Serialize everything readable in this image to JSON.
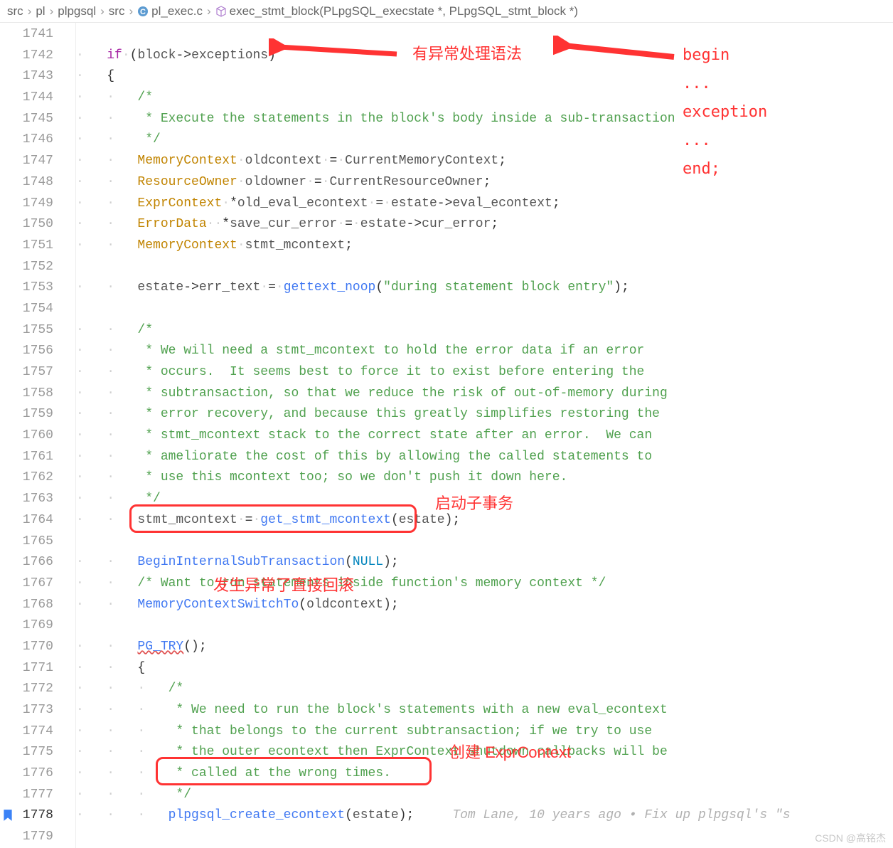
{
  "breadcrumb": {
    "items": [
      "src",
      "pl",
      "plpgsql",
      "src",
      "pl_exec.c",
      "exec_stmt_block(PLpgSQL_execstate *, PLpgSQL_stmt_block *)"
    ],
    "file_icon": "C",
    "func_icon": "cube"
  },
  "line_start": 1741,
  "line_end": 1779,
  "bookmark_line": 1778,
  "annotations": {
    "a1": "有异常处理语法",
    "a2_lines": [
      "begin",
      "...",
      "exception",
      "...",
      "end;"
    ],
    "a3": "启动子事务",
    "a4": "发生异常了直接回滚",
    "a5": "创建 ExprContext"
  },
  "code": {
    "l1742": {
      "kw": "if",
      "expr_l": "block",
      "op": "->",
      "expr_r": "exceptions"
    },
    "l1744_cm": "/*",
    "l1745_cm": " * Execute the statements in the block's body inside a sub-transaction",
    "l1746_cm": " */",
    "l1747": {
      "ty": "MemoryContext",
      "var": "oldcontext",
      "rhs": "CurrentMemoryContext"
    },
    "l1748": {
      "ty": "ResourceOwner",
      "var": "oldowner",
      "rhs": "CurrentResourceOwner"
    },
    "l1749": {
      "ty": "ExprContext",
      "ptr": "*",
      "var": "old_eval_econtext",
      "rhs_l": "estate",
      "op": "->",
      "rhs_r": "eval_econtext"
    },
    "l1750": {
      "ty": "ErrorData",
      "ptr": "*",
      "var": "save_cur_error",
      "rhs_l": "estate",
      "op": "->",
      "rhs_r": "cur_error"
    },
    "l1751": {
      "ty": "MemoryContext",
      "var": "stmt_mcontext"
    },
    "l1753": {
      "lhs_l": "estate",
      "op": "->",
      "lhs_r": "err_text",
      "fn": "gettext_noop",
      "arg": "\"during statement block entry\""
    },
    "l1755_cm": "/*",
    "l1756_cm": " * We will need a stmt_mcontext to hold the error data if an error",
    "l1757_cm": " * occurs.  It seems best to force it to exist before entering the",
    "l1758_cm": " * subtransaction, so that we reduce the risk of out-of-memory during",
    "l1759_cm": " * error recovery, and because this greatly simplifies restoring the",
    "l1760_cm": " * stmt_mcontext stack to the correct state after an error.  We can",
    "l1761_cm": " * ameliorate the cost of this by allowing the called statements to",
    "l1762_cm": " * use this mcontext too; so we don't push it down here.",
    "l1763_cm": " */",
    "l1764": {
      "lhs": "stmt_mcontext",
      "fn": "get_stmt_mcontext",
      "arg": "estate"
    },
    "l1766": {
      "fn": "BeginInternalSubTransaction",
      "arg": "NULL"
    },
    "l1767_cm": "/* Want to run statements inside function's memory context */",
    "l1768": {
      "fn": "MemoryContextSwitchTo",
      "arg": "oldcontext"
    },
    "l1770": {
      "fn": "PG_TRY"
    },
    "l1772_cm": "/*",
    "l1773_cm": " * We need to run the block's statements with a new eval_econtext",
    "l1774_cm": " * that belongs to the current subtransaction; if we try to use",
    "l1775_cm": " * the outer econtext then ExprContext shutdown callbacks will be",
    "l1776_cm": " * called at the wrong times.",
    "l1777_cm": " */",
    "l1778": {
      "fn": "plpgsql_create_econtext",
      "arg": "estate"
    },
    "blame": "Tom Lane, 10 years ago • Fix up plpgsql's \"s"
  },
  "watermark": "CSDN @高铭杰"
}
